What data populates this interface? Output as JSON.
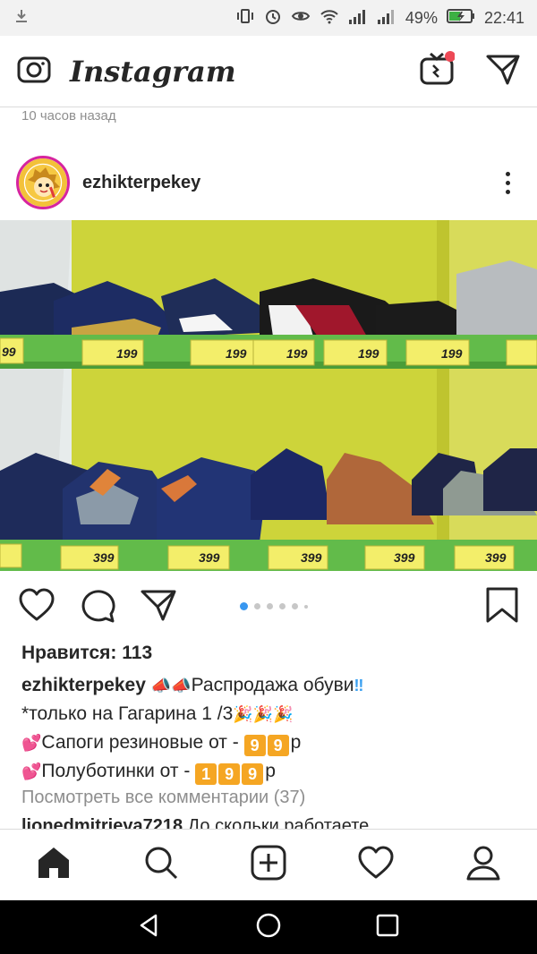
{
  "status_bar": {
    "battery": "49%",
    "time": "22:41"
  },
  "app": {
    "title": "Instagram"
  },
  "post": {
    "time_ago": "10 часов назад",
    "username": "ezhikterpekey",
    "carousel_dots": 6,
    "carousel_active": 0,
    "likes": "Нравится: 113",
    "caption": {
      "username": "ezhikterpekey",
      "line1_text": "Распродажа обуви",
      "line2_text": "*только на Гагарина 1 /3",
      "line3_text": "Сапоги резиновые от -",
      "line3_digits": [
        "9",
        "9"
      ],
      "line3_suffix": "р",
      "line4_text": "Полуботинки от -",
      "line4_digits": [
        "1",
        "9",
        "9"
      ],
      "line4_suffix": "р"
    },
    "view_all_comments": "Посмотреть все комментарии (37)",
    "comment_preview": {
      "username": "lionedmitrieva7218",
      "text": "До скольки работаете"
    },
    "price_tags": {
      "top": [
        "199",
        "199",
        "199",
        "199",
        "199",
        "199"
      ],
      "bottom": [
        "399",
        "399",
        "399",
        "399",
        "399",
        "399"
      ]
    }
  },
  "colors": {
    "accent": "#3897f0",
    "shelf_wall": "#cfd63a",
    "shelf_edge": "#6cc04a",
    "price_tag": "#f3ee6a"
  }
}
